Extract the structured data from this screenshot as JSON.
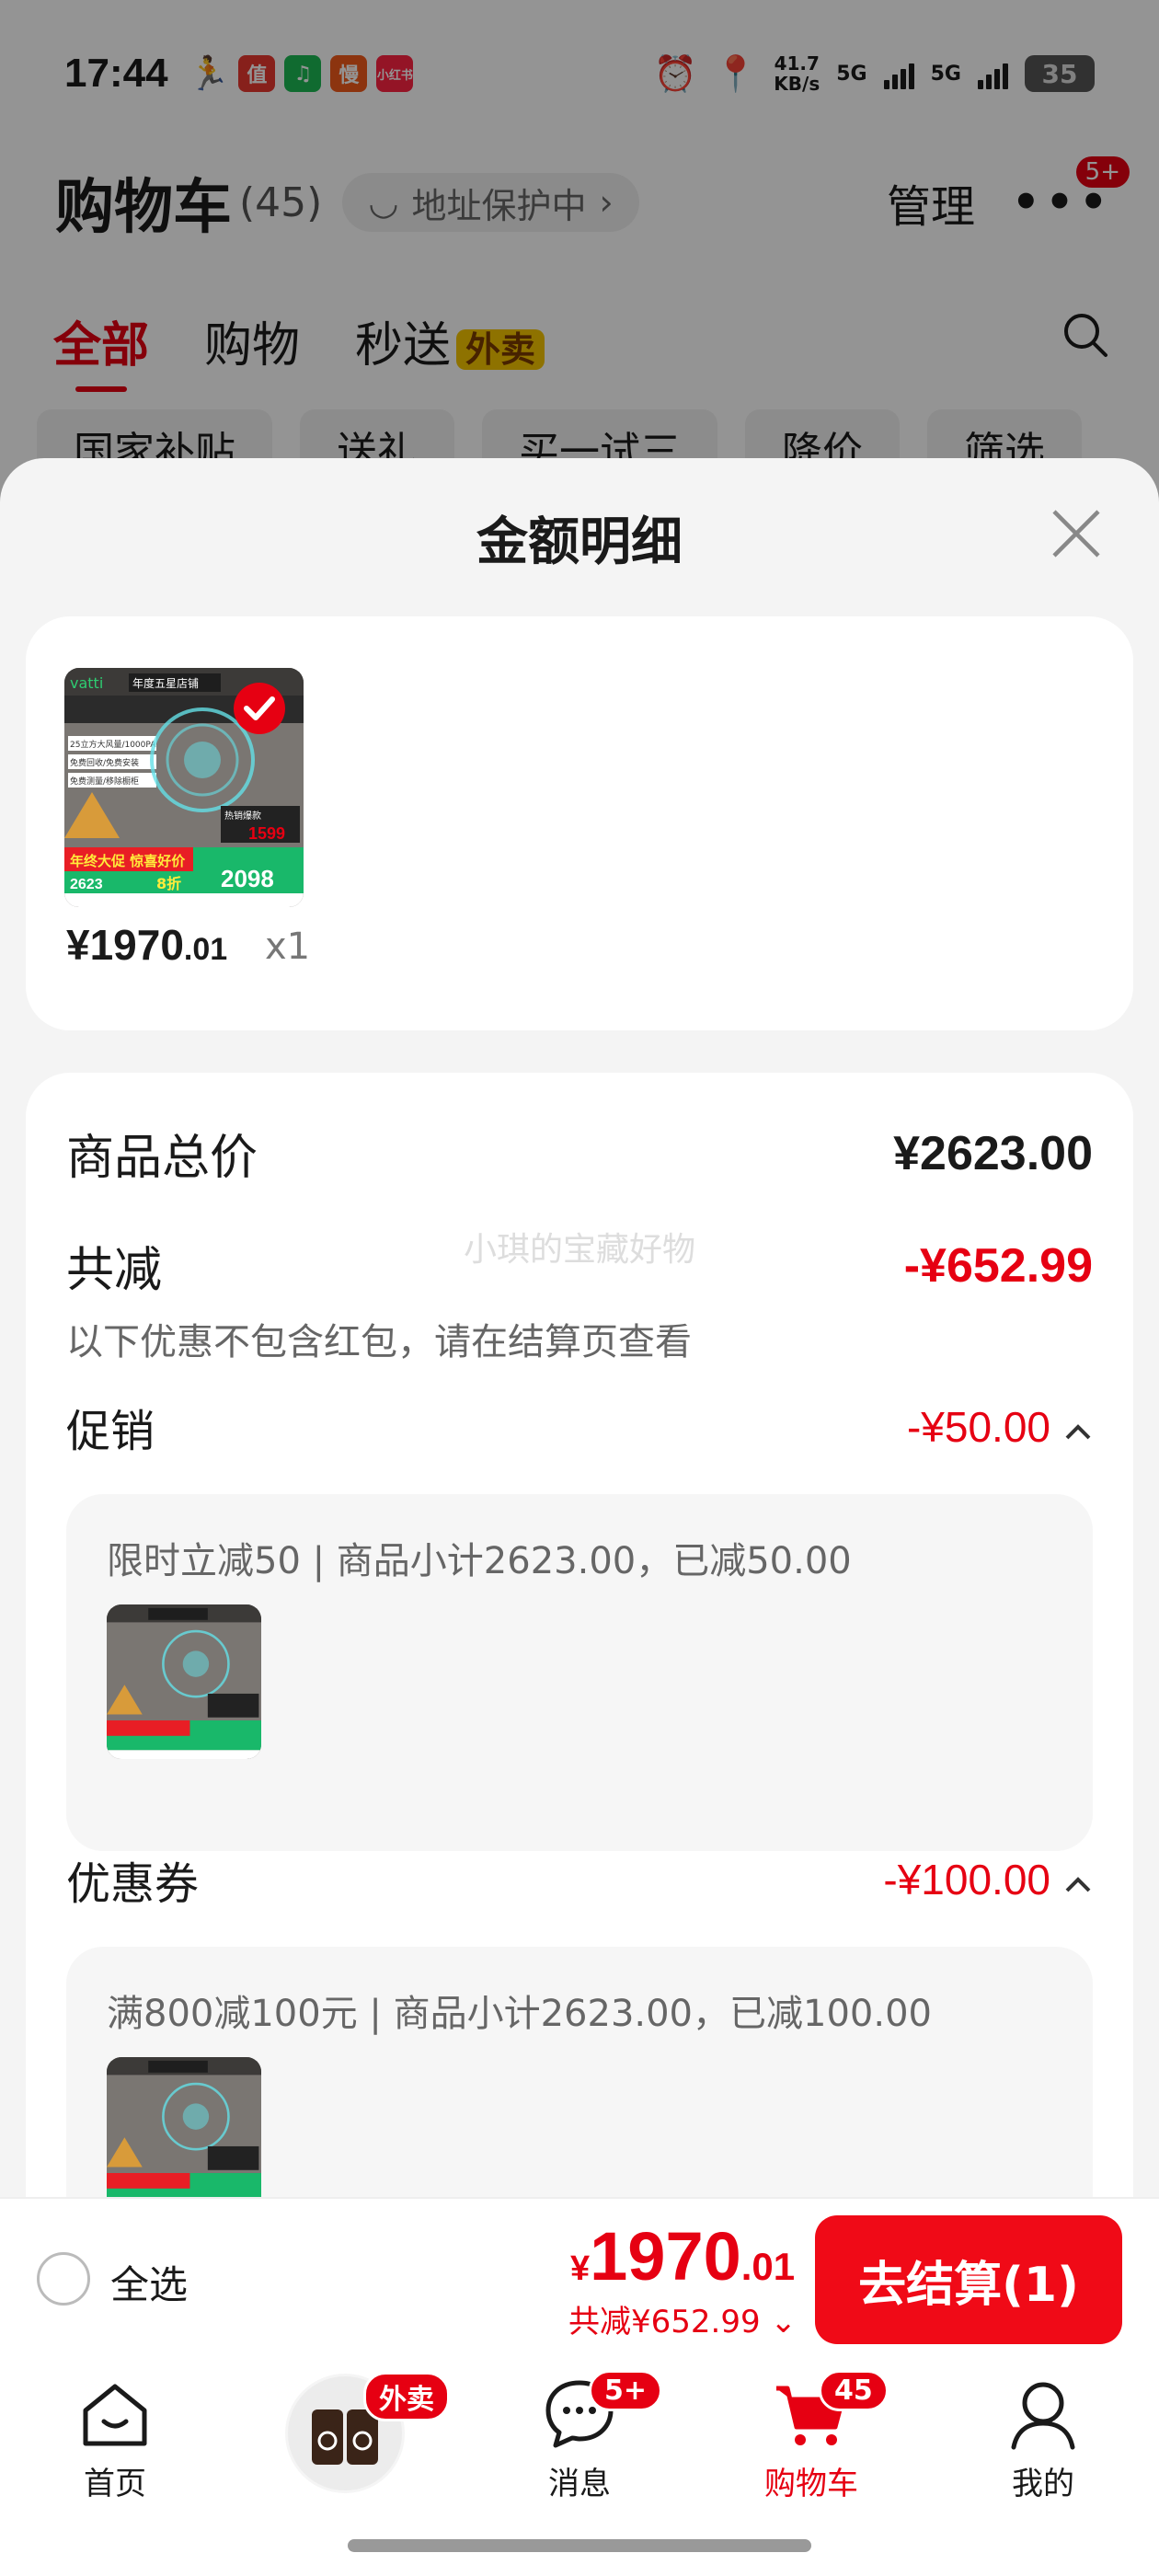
{
  "status": {
    "time": "17:44",
    "net_speed_value": "41.7",
    "net_speed_unit": "KB/s",
    "sig1": "5G",
    "sig2": "5G",
    "battery": "35",
    "app_icons": [
      {
        "label": "值",
        "color": "#e8382f"
      },
      {
        "label": "♫",
        "color": "#1db954"
      },
      {
        "label": "慢",
        "color": "#f25b1b"
      },
      {
        "label": "小红书",
        "color": "#ff2442"
      }
    ]
  },
  "header": {
    "title": "购物车",
    "count": "(45)",
    "address": "地址保护中",
    "manage": "管理",
    "more_badge": "5+"
  },
  "tabs": {
    "all": "全部",
    "shop": "购物",
    "fast": "秒送",
    "fast_tag": "外卖"
  },
  "chips": [
    "国家补贴",
    "送礼",
    "买一试三",
    "降价",
    "筛选"
  ],
  "sheet": {
    "title": "金额明细",
    "item": {
      "price_int": "¥1970",
      "price_dec": ".01",
      "qty": "x1",
      "thumb": {
        "brand": "vatti",
        "store": "年度五星店铺",
        "line1": "25立方大风量/1000PA",
        "line2": "免费回收/免费安装",
        "line3": "免费测量/移除橱柜",
        "promo_price": "1599",
        "promo_label": "热销爆款",
        "orig": "2623",
        "discount": "8折",
        "final": "2098",
        "banner": "年终大促 惊喜好价"
      }
    },
    "total_label": "商品总价",
    "total_value": "¥2623.00",
    "reduce_label": "共减",
    "reduce_value": "-¥652.99",
    "reduce_note": "以下优惠不包含红包，请在结算页查看",
    "watermark": "小琪的宝藏好物",
    "promo_label": "促销",
    "promo_value": "-¥50.00",
    "promo_detail": "限时立减50 | 商品小计2623.00，已减50.00",
    "coupon_label": "优惠券",
    "coupon_value": "-¥100.00",
    "coupon_detail": "满800减100元 | 商品小计2623.00，已减100.00"
  },
  "footer": {
    "select_all": "全选",
    "yen": "¥",
    "total_int": "1970",
    "total_dec": ".01",
    "total_reduce": "共减¥652.99",
    "checkout": "去结算(1)"
  },
  "nav": {
    "home": "首页",
    "waimai_badge": "外卖",
    "msg": "消息",
    "msg_badge": "5+",
    "cart": "购物车",
    "cart_badge": "45",
    "me": "我的"
  },
  "colors": {
    "accent": "#e60012",
    "checkout": "#f00a17"
  }
}
